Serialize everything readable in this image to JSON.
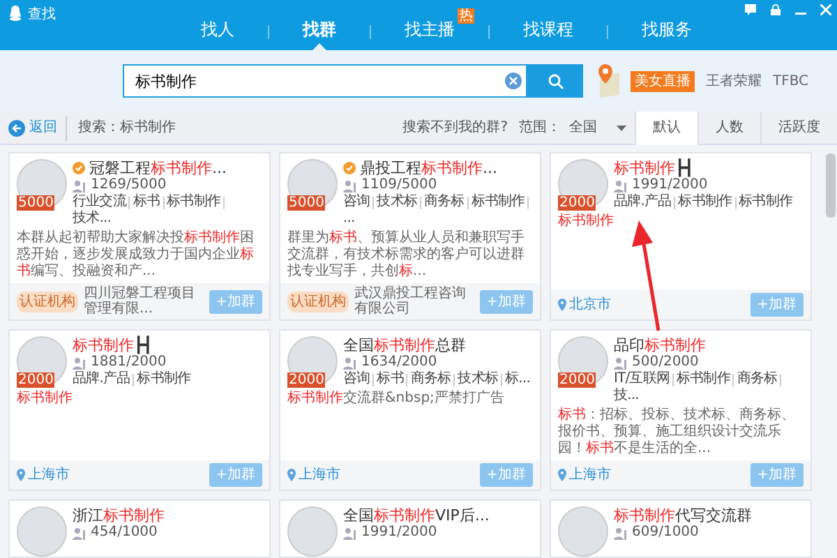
{
  "window": {
    "title": "查找"
  },
  "nav_tabs": [
    {
      "label": "找人",
      "selected": false
    },
    {
      "label": "找群",
      "selected": true
    },
    {
      "label": "找主播",
      "selected": false,
      "badge": "热"
    },
    {
      "label": "找课程",
      "selected": false
    },
    {
      "label": "找服务",
      "selected": false
    }
  ],
  "search": {
    "value": "标书制作"
  },
  "promo": {
    "badge": "美女直播",
    "links": [
      "王者荣耀",
      "TFBC"
    ]
  },
  "toolbar": {
    "back": "返回",
    "query": "搜索：标书制作",
    "help_link": "搜索不到我的群?",
    "scope_label": "范围：",
    "scope_value": "全国",
    "sort_tabs": [
      {
        "label": "默认",
        "selected": true
      },
      {
        "label": "人数",
        "selected": false
      },
      {
        "label": "活跃度",
        "selected": false
      }
    ]
  },
  "groups": [
    {
      "verified": true,
      "size_badge": "5000",
      "title": "冠磐工程**标书制作**...",
      "members": "1269/5000",
      "tags": [
        "行业交流",
        "标书",
        "标书制作",
        "技术..."
      ],
      "description": "本群从起初帮助大家解决投**标书制作**困惑开始，逐步发展成致力于国内企业**标书**编写、投融资和产...",
      "footer": {
        "kind": "certified",
        "cert_label": "认证机构",
        "org": "四川冠磐工程项目管理有限..."
      },
      "join_label": "+加群"
    },
    {
      "verified": true,
      "size_badge": "5000",
      "title": "鼎投工程**标书制作**...",
      "members": "1109/5000",
      "tags": [
        "咨询",
        "技术标",
        "商务标",
        "标书制作",
        "..."
      ],
      "description": "群里为**标书**、预算从业人员和兼职写手交流群，有技术标需求的客户可以进群找专业写手，共创**标**...",
      "footer": {
        "kind": "certified",
        "cert_label": "认证机构",
        "org": "武汉鼎投工程咨询有限公司"
      },
      "join_label": "+加群"
    },
    {
      "verified": false,
      "size_badge": "2000",
      "title": "**标书制作**┣┫",
      "members": "1991/2000",
      "tags": [
        "品牌.产品",
        "标书制作",
        "标书制作"
      ],
      "description": "**标书制作**",
      "footer": {
        "kind": "location",
        "location": "北京市"
      },
      "join_label": "+加群"
    },
    {
      "verified": false,
      "size_badge": "2000",
      "title": "**标书制作**┣┫",
      "members": "1881/2000",
      "tags": [
        "品牌.产品",
        "标书制作"
      ],
      "description": "**标书制作**",
      "footer": {
        "kind": "location",
        "location": "上海市"
      },
      "join_label": "+加群"
    },
    {
      "verified": false,
      "size_badge": "2000",
      "title": "全国**标书制作**总群",
      "members": "1634/2000",
      "tags": [
        "咨询",
        "标书",
        "商务标",
        "技术标",
        "标..."
      ],
      "description": "**标书制作**交流群&nbsp;严禁打广告",
      "footer": {
        "kind": "location",
        "location": "上海市"
      },
      "join_label": "+加群"
    },
    {
      "verified": false,
      "size_badge": "2000",
      "title": "品印**标书制作**",
      "members": "500/2000",
      "tags": [
        "IT/互联网",
        "标书制作",
        "商务标",
        "技..."
      ],
      "description": "**标书**：招标、投标、技术标、商务标、报价书、预算、施工组织设计交流乐园！**标书**不是生活的全...",
      "footer": {
        "kind": "location",
        "location": "上海市"
      },
      "join_label": "+加群"
    },
    {
      "verified": false,
      "title": "浙江**标书制作**",
      "members": "454/1000"
    },
    {
      "verified": false,
      "title": "全国**标书制作**VIP后...",
      "members": "1991/2000"
    },
    {
      "verified": false,
      "title": "**标书制作**代写交流群",
      "members": "609/1000"
    }
  ]
}
